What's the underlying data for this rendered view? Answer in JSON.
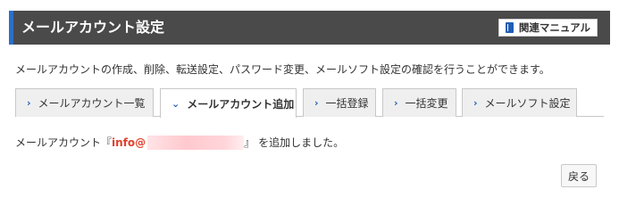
{
  "header": {
    "title": "メールアカウント設定",
    "manual_label": "関連マニュアル",
    "manual_icon": "book-icon",
    "accent_color": "#2a70c8"
  },
  "description": "メールアカウントの作成、削除、転送設定、パスワード変更、メールソフト設定の確認を行うことができます。",
  "tabs": [
    {
      "label": "メールアカウント一覧",
      "active": false
    },
    {
      "label": "メールアカウント追加",
      "active": true
    },
    {
      "label": "一括登録",
      "active": false
    },
    {
      "label": "一括変更",
      "active": false
    },
    {
      "label": "メールソフト設定",
      "active": false
    }
  ],
  "message": {
    "prefix": "メールアカウント",
    "open_quote": "『",
    "email_visible": "info@",
    "close_quote": "』",
    "suffix": "を追加しました。",
    "email_color": "#e0402c"
  },
  "back_button": "戻る"
}
